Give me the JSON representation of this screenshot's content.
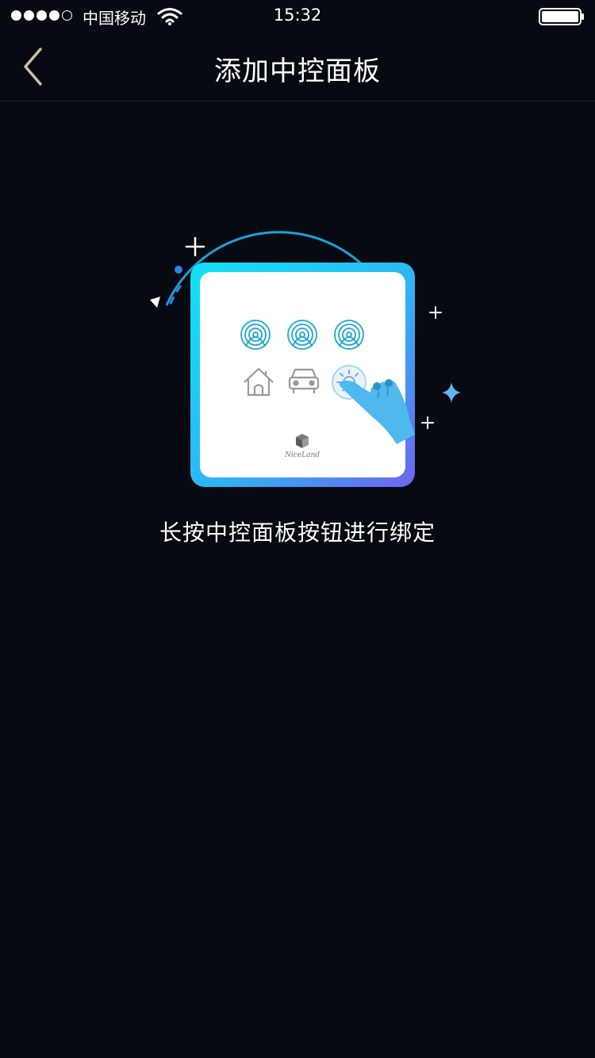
{
  "status_bar": {
    "carrier": "中国移动",
    "time": "15:32",
    "signal_bars_filled": 4,
    "signal_bars_total": 5,
    "icons": [
      "wifi-icon",
      "battery-icon"
    ]
  },
  "nav": {
    "title": "添加中控面板",
    "back_icon": "chevron-left-icon"
  },
  "panel": {
    "brand": "NiceLand",
    "buttons": [
      "fingerprint-icon",
      "fingerprint-icon",
      "fingerprint-icon",
      "home-icon",
      "car-icon",
      "sun-icon"
    ],
    "pressed_button": "sun-icon"
  },
  "hint": "长按中控面板按钮进行绑定",
  "colors": {
    "background": "#070b11",
    "accent_cyan": "#12d6f2",
    "accent_purple": "#6b66f0",
    "fingerprint": "#1aa6cf",
    "hand": "#4fb8ee"
  }
}
